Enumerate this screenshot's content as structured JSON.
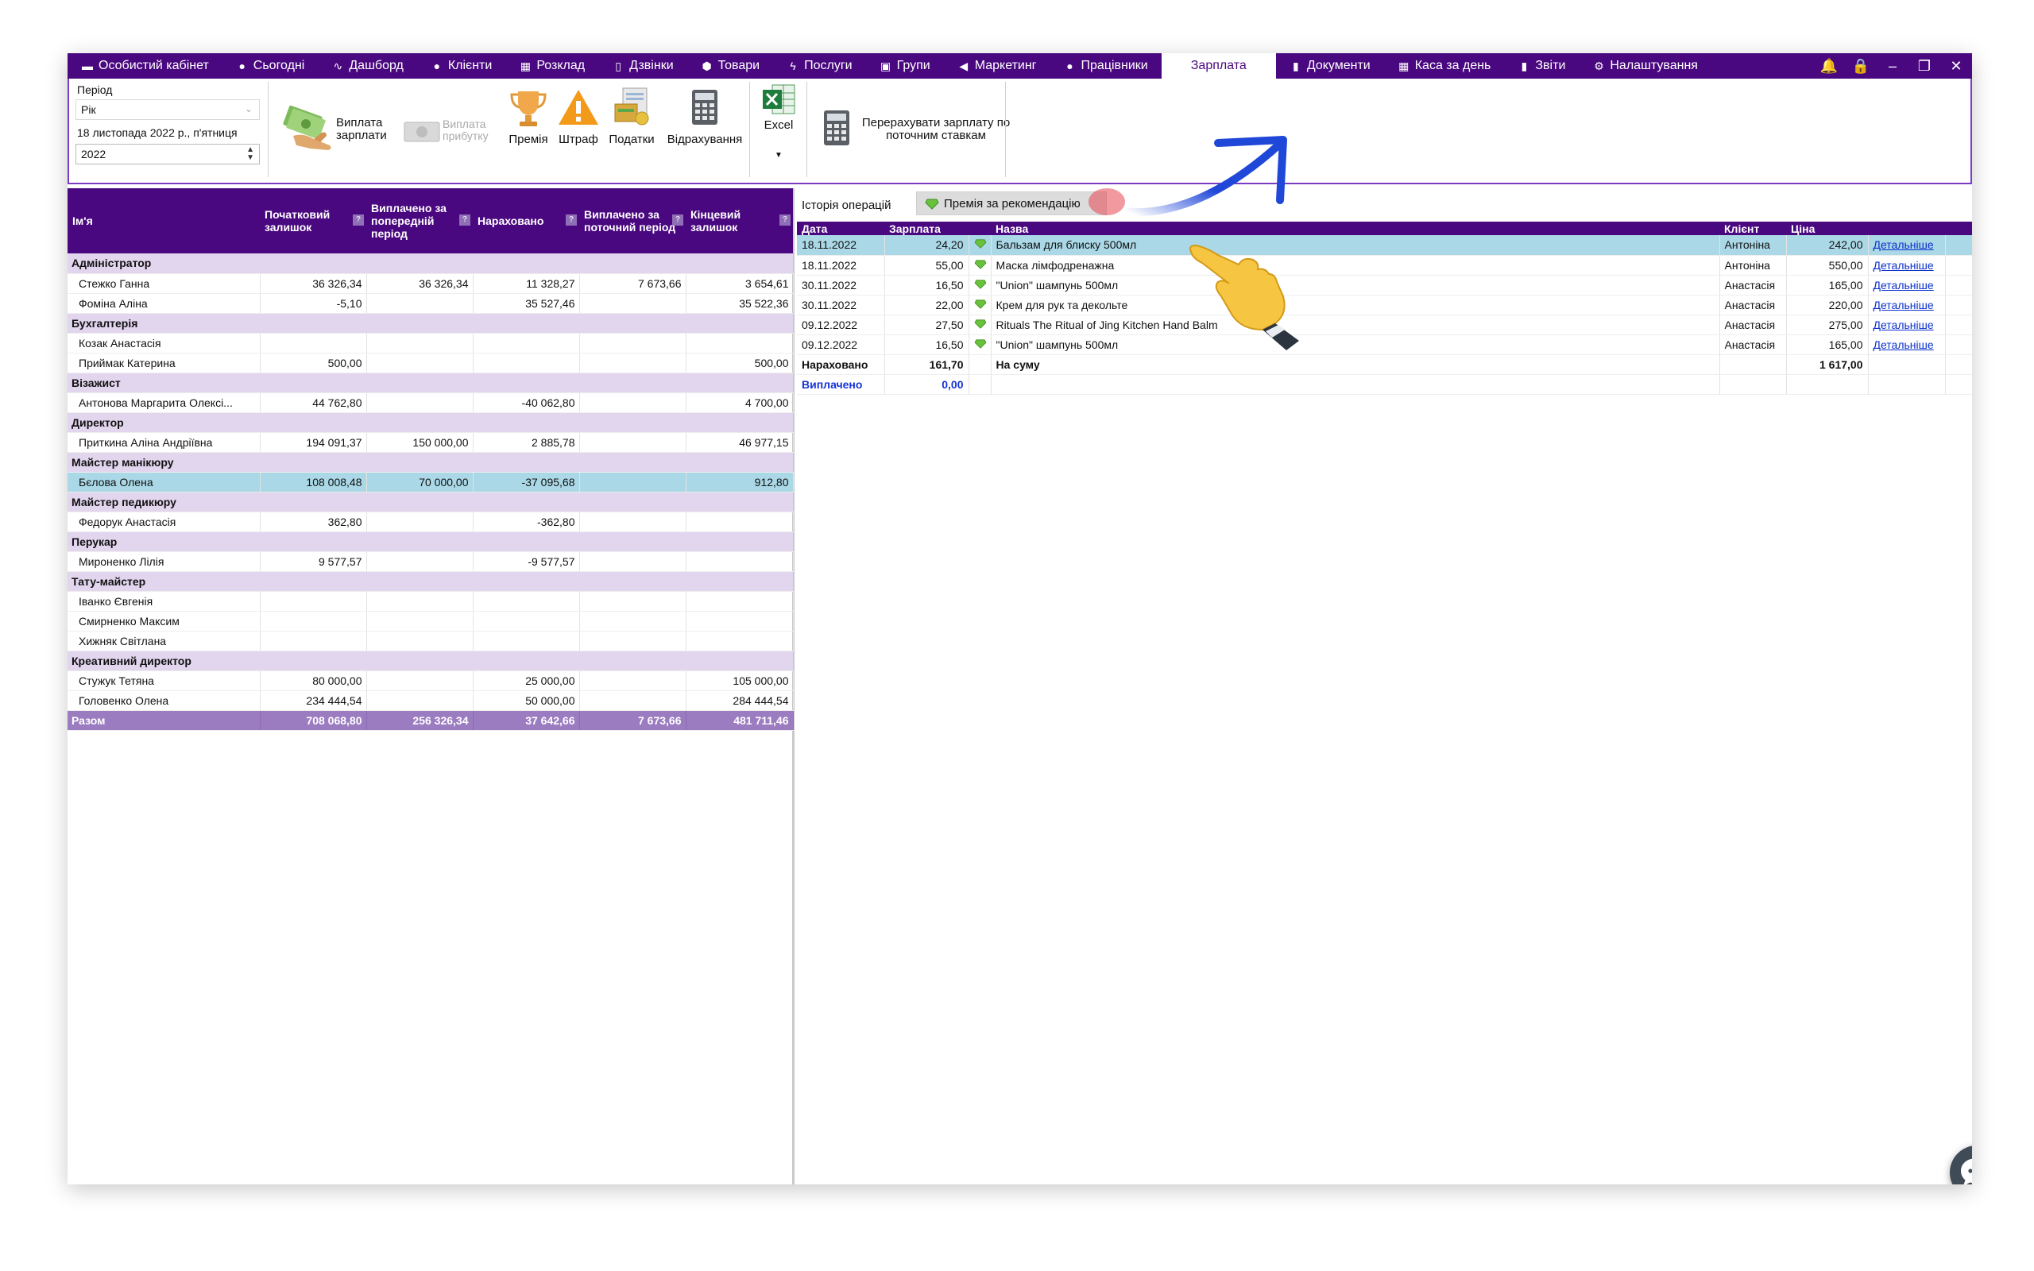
{
  "nav": {
    "items": [
      {
        "label": "Особистий кабінет",
        "icon": "wallet-icon"
      },
      {
        "label": "Сьогодні",
        "icon": "clock-icon"
      },
      {
        "label": "Дашборд",
        "icon": "pulse-icon"
      },
      {
        "label": "Клієнти",
        "icon": "user-icon"
      },
      {
        "label": "Розклад",
        "icon": "calendar-icon"
      },
      {
        "label": "Дзвінки",
        "icon": "phone-icon"
      },
      {
        "label": "Товари",
        "icon": "box-icon"
      },
      {
        "label": "Послуги",
        "icon": "bolt-icon"
      },
      {
        "label": "Групи",
        "icon": "group-icon"
      },
      {
        "label": "Маркетинг",
        "icon": "megaphone-icon"
      },
      {
        "label": "Працівники",
        "icon": "person-icon"
      },
      {
        "label": "Зарплата",
        "icon": ""
      },
      {
        "label": "Документи",
        "icon": "document-icon"
      },
      {
        "label": "Каса за день",
        "icon": "cash-register-icon"
      },
      {
        "label": "Звіти",
        "icon": "bar-chart-icon"
      },
      {
        "label": "Налаштування",
        "icon": "gear-icon"
      }
    ],
    "active": "Зарплата",
    "controls": [
      "bell-icon",
      "lock-icon",
      "minimize-icon",
      "restore-icon",
      "close-icon"
    ]
  },
  "ribbon": {
    "period_label": "Період",
    "period_value": "Рік",
    "date_text": "18 листопада 2022 р., п'ятниця",
    "year_value": "2022",
    "pay_salary": "Виплата зарплати",
    "pay_profit": "Виплата прибутку",
    "bonus": "Премія",
    "fine": "Штраф",
    "taxes": "Податки",
    "deductions": "Відрахування",
    "excel": "Excel",
    "recalc": "Перерахувати зарплату по поточним ставкам"
  },
  "left_table": {
    "headers": [
      "Ім'я",
      "Початковий залишок",
      "Виплачено за попередній період",
      "Нараховано",
      "Виплачено за поточний період",
      "Кінцевий залишок"
    ],
    "rows": [
      {
        "type": "group",
        "name": "Адміністратор"
      },
      {
        "type": "emp",
        "name": "Стежко Ганна",
        "start": "36 326,34",
        "paid_prev": "36 326,34",
        "accrued": "11 328,27",
        "paid_cur": "7 673,66",
        "end": "3 654,61"
      },
      {
        "type": "emp",
        "name": "Фоміна Аліна",
        "start": "-5,10",
        "paid_prev": "",
        "accrued": "35 527,46",
        "paid_cur": "",
        "end": "35 522,36"
      },
      {
        "type": "group",
        "name": "Бухгалтерія"
      },
      {
        "type": "emp",
        "name": "Козак Анастасія",
        "start": "",
        "paid_prev": "",
        "accrued": "",
        "paid_cur": "",
        "end": ""
      },
      {
        "type": "emp",
        "name": "Приймак Катерина",
        "start": "500,00",
        "paid_prev": "",
        "accrued": "",
        "paid_cur": "",
        "end": "500,00"
      },
      {
        "type": "group",
        "name": "Візажист"
      },
      {
        "type": "emp",
        "name": "Антонова Маргарита Олексі...",
        "start": "44 762,80",
        "paid_prev": "",
        "accrued": "-40 062,80",
        "paid_cur": "",
        "end": "4 700,00"
      },
      {
        "type": "group",
        "name": "Директор"
      },
      {
        "type": "emp",
        "name": "Приткина Аліна Андріївна",
        "start": "194 091,37",
        "paid_prev": "150 000,00",
        "accrued": "2 885,78",
        "paid_cur": "",
        "end": "46 977,15"
      },
      {
        "type": "group",
        "name": "Майстер манікюру"
      },
      {
        "type": "emp",
        "selected": true,
        "name": "Бєлова Олена",
        "start": "108 008,48",
        "paid_prev": "70 000,00",
        "accrued": "-37 095,68",
        "paid_cur": "",
        "end": "912,80"
      },
      {
        "type": "group",
        "name": "Майстер педикюру"
      },
      {
        "type": "emp",
        "name": "Федорук Анастасія",
        "start": "362,80",
        "paid_prev": "",
        "accrued": "-362,80",
        "paid_cur": "",
        "end": ""
      },
      {
        "type": "group",
        "name": "Перукар"
      },
      {
        "type": "emp",
        "name": "Мироненко Лілія",
        "start": "9 577,57",
        "paid_prev": "",
        "accrued": "-9 577,57",
        "paid_cur": "",
        "end": ""
      },
      {
        "type": "group",
        "name": "Тату-майстер"
      },
      {
        "type": "emp",
        "name": "Іванко Євгенія",
        "start": "",
        "paid_prev": "",
        "accrued": "",
        "paid_cur": "",
        "end": ""
      },
      {
        "type": "emp",
        "name": "Смирненко Максим",
        "start": "",
        "paid_prev": "",
        "accrued": "",
        "paid_cur": "",
        "end": ""
      },
      {
        "type": "emp",
        "name": "Хижняк Світлана",
        "start": "",
        "paid_prev": "",
        "accrued": "",
        "paid_cur": "",
        "end": ""
      },
      {
        "type": "group",
        "name": "Креативний директор"
      },
      {
        "type": "emp",
        "name": "Стужук Тетяна",
        "start": "80 000,00",
        "paid_prev": "",
        "accrued": "25 000,00",
        "paid_cur": "",
        "end": "105 000,00"
      },
      {
        "type": "emp",
        "name": "Головенко Олена",
        "start": "234 444,54",
        "paid_prev": "",
        "accrued": "50 000,00",
        "paid_cur": "",
        "end": "284 444,54"
      }
    ],
    "total": {
      "name": "Разом",
      "start": "708 068,80",
      "paid_prev": "256 326,34",
      "accrued": "37 642,66",
      "paid_cur": "7 673,66",
      "end": "481 711,46"
    }
  },
  "history": {
    "label": "Історія операцій",
    "button": "Премія за рекомендацію",
    "headers": [
      "Дата",
      "Зарплата",
      "",
      "Назва",
      "Клієнт",
      "Ціна",
      ""
    ],
    "rows": [
      {
        "date": "18.11.2022",
        "salary": "24,20",
        "name": "Бальзам для блиску 500мл",
        "client": "Антоніна",
        "price": "242,00",
        "link": "Детальніше",
        "selected": true
      },
      {
        "date": "18.11.2022",
        "salary": "55,00",
        "name": "Маска лімфодренажна",
        "client": "Антоніна",
        "price": "550,00",
        "link": "Детальніше"
      },
      {
        "date": "30.11.2022",
        "salary": "16,50",
        "name": "\"Union\" шампунь 500мл",
        "client": "Анастасія",
        "price": "165,00",
        "link": "Детальніше"
      },
      {
        "date": "30.11.2022",
        "salary": "22,00",
        "name": "Крем для рук та декольте",
        "client": "Анастасія",
        "price": "220,00",
        "link": "Детальніше"
      },
      {
        "date": "09.12.2022",
        "salary": "27,50",
        "name": "Rituals The Ritual of Jing Kitchen Hand Balm",
        "client": "Анастасія",
        "price": "275,00",
        "link": "Детальніше"
      },
      {
        "date": "09.12.2022",
        "salary": "16,50",
        "name": "\"Union\" шампунь 500мл",
        "client": "Анастасія",
        "price": "165,00",
        "link": "Детальніше"
      }
    ],
    "summary": {
      "accrued_label": "Нараховано",
      "accrued_value": "161,70",
      "sum_label": "На суму",
      "sum_value": "1 617,00",
      "paid_label": "Виплачено",
      "paid_value": "0,00"
    }
  },
  "colors": {
    "brand": "#4a0880",
    "group_row": "#e2d5ee",
    "selected_row": "#aad8e6",
    "total_row": "#9c7cc0",
    "arrow": "#1f47d8",
    "link": "#0a2fcc"
  }
}
